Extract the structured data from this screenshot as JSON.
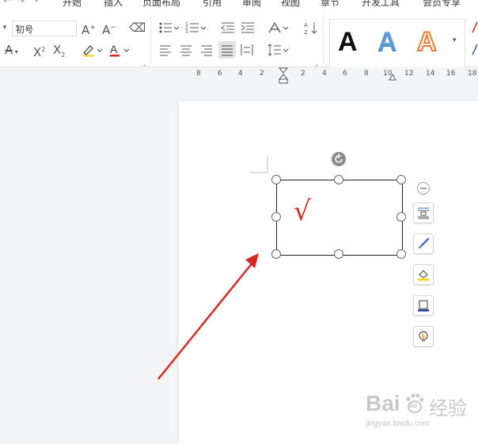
{
  "menu": {
    "items": [
      "开始",
      "插入",
      "页面布局",
      "引用",
      "审阅",
      "视图",
      "章节",
      "开发工具",
      "会员专享"
    ]
  },
  "ribbon": {
    "font_size_value": "初号"
  },
  "style_gallery": {
    "letters": [
      "A",
      "A",
      "A"
    ]
  },
  "ruler": {
    "ticks": [
      "8",
      "6",
      "4",
      "2",
      "2",
      "4",
      "6",
      "8",
      "10",
      "12",
      "14",
      "16",
      "18"
    ]
  },
  "textbox": {
    "content": "√"
  },
  "colors": {
    "red_accent": "#d9271f",
    "blue_style": "#5b9bd5",
    "orange_style": "#ed7d31",
    "highlight_yellow": "#f5d300"
  },
  "watermark": {
    "brand": "Bai",
    "brand_icon": "du",
    "tagline": "经验",
    "url": "jingyan.baidu.com"
  }
}
